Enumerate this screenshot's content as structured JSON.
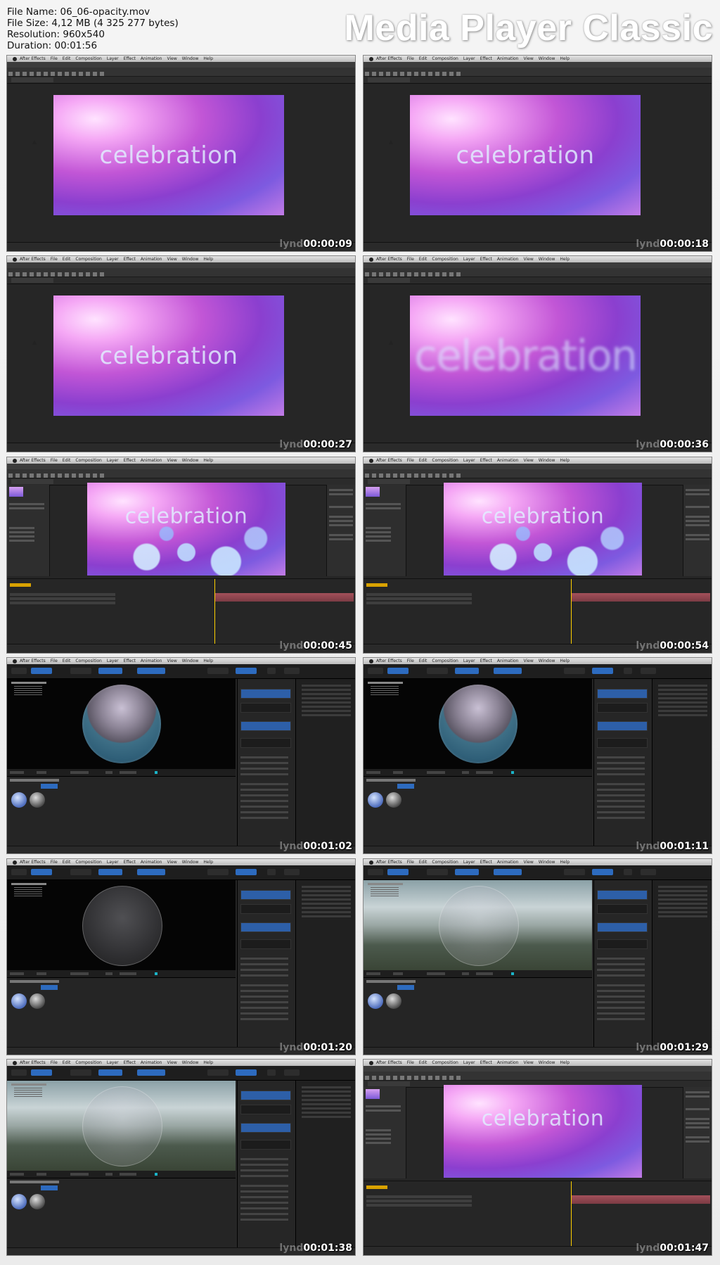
{
  "file_info": {
    "name_line": "File Name: 06_06-opacity.mov",
    "size_line": "File Size: 4,12 MB (4 325 277 bytes)",
    "resolution_line": "Resolution: 960x540",
    "duration_line": "Duration: 00:01:56"
  },
  "brand": "Media Player Classic",
  "viewer_text": "celebration",
  "watermark_prefix": "lynd",
  "ae_menu": [
    "After Effects",
    "File",
    "Edit",
    "Composition",
    "Layer",
    "Effect",
    "Animation",
    "View",
    "Window",
    "Help"
  ],
  "thumbnails": [
    {
      "timestamp": "00:00:09",
      "kind": "ae-full"
    },
    {
      "timestamp": "00:00:18",
      "kind": "ae-full"
    },
    {
      "timestamp": "00:00:27",
      "kind": "ae-full"
    },
    {
      "timestamp": "00:00:36",
      "kind": "ae-full-blur"
    },
    {
      "timestamp": "00:00:45",
      "kind": "ae-comp"
    },
    {
      "timestamp": "00:00:54",
      "kind": "ae-comp"
    },
    {
      "timestamp": "00:01:02",
      "kind": "e3d-dark"
    },
    {
      "timestamp": "00:01:11",
      "kind": "e3d-dark"
    },
    {
      "timestamp": "00:01:20",
      "kind": "e3d-dark-glass"
    },
    {
      "timestamp": "00:01:29",
      "kind": "e3d-sky"
    },
    {
      "timestamp": "00:01:38",
      "kind": "e3d-sky"
    },
    {
      "timestamp": "00:01:47",
      "kind": "ae-comp-plain"
    }
  ],
  "colors": {
    "timecode": "#d9a200",
    "e3d_blue": "#2d6bbf",
    "timeline_bar": "#a3505a"
  }
}
